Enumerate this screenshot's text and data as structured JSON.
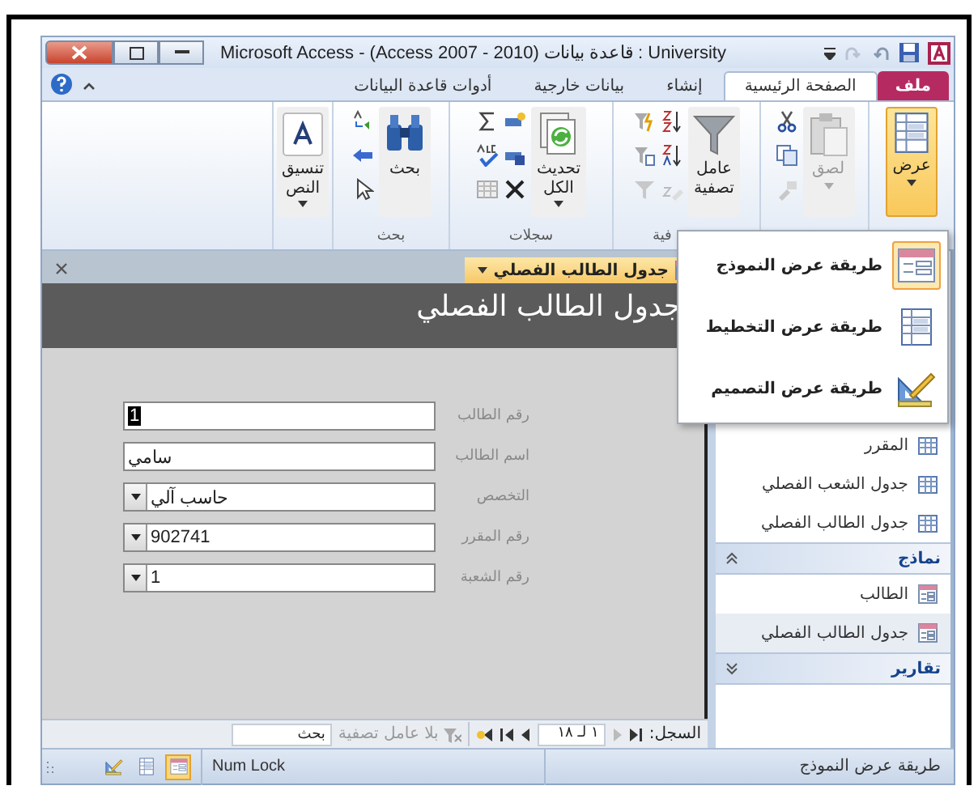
{
  "window": {
    "title": "Microsoft Access  -  (Access 2007 - 2010) قاعدة بيانات : University"
  },
  "tabs": [
    {
      "label": "ملف",
      "kind": "file",
      "selected": false
    },
    {
      "label": "الصفحة الرئيسية",
      "kind": "normal",
      "selected": true
    },
    {
      "label": "إنشاء",
      "kind": "normal",
      "selected": false
    },
    {
      "label": "بيانات خارجية",
      "kind": "normal",
      "selected": false
    },
    {
      "label": "أدوات قاعدة البيانات",
      "kind": "normal",
      "selected": false
    }
  ],
  "ribbon": {
    "groups": [
      {
        "kind": "view",
        "button": {
          "label": "عرض",
          "selected": true,
          "disabled": false
        }
      },
      {
        "kind": "clipboard",
        "button": {
          "label": "لصق",
          "selected": false,
          "disabled": true
        }
      },
      {
        "kind": "sort_filter",
        "label": "فية",
        "button": {
          "label": "عامل\nتصفية",
          "selected": false,
          "disabled": false
        }
      },
      {
        "kind": "records",
        "label": "سجلات",
        "button": {
          "label": "تحديث\nالكل",
          "selected": false,
          "disabled": false
        }
      },
      {
        "kind": "find",
        "label": "بحث",
        "button": {
          "label": "بحث",
          "selected": false,
          "disabled": false
        }
      },
      {
        "kind": "text_format",
        "button": {
          "label": "تنسيق\nالنص",
          "selected": false,
          "disabled": false
        }
      }
    ]
  },
  "view_menu": {
    "items": [
      {
        "label": "طريقة عرض النموذج",
        "kind": "form",
        "selected": true
      },
      {
        "label": "طريقة عرض التخطيط",
        "kind": "layout",
        "selected": false
      },
      {
        "label": "طريقة عرض التصميم",
        "kind": "design",
        "selected": false
      }
    ]
  },
  "document": {
    "tabs": [
      {
        "label": "جدول الطالب الفصلي",
        "selected": true
      }
    ],
    "form": {
      "title": "جدول الطالب الفصلي",
      "fields": [
        {
          "label": "رقم الطالب",
          "value": "1",
          "kind": "text",
          "focused": true
        },
        {
          "label": "اسم الطالب",
          "value": "سامي",
          "kind": "text",
          "focused": false
        },
        {
          "label": "التخصص",
          "value": "حاسب آلي",
          "kind": "combo",
          "focused": false
        },
        {
          "label": "رقم المقرر",
          "value": "902741",
          "kind": "combo",
          "focused": false
        },
        {
          "label": "رقم الشعبة",
          "value": "1",
          "kind": "combo",
          "focused": false
        }
      ]
    },
    "record_nav": {
      "label": "السجل:",
      "position": "١ لـ ١٨",
      "filter": "بلا عامل تصفية",
      "search": {
        "placeholder": "بحث"
      }
    }
  },
  "nav_pane": {
    "groups": [
      {
        "kind": "table",
        "items": [
          {
            "label": "المقرر",
            "selected": false
          },
          {
            "label": "جدول الشعب الفصلي",
            "selected": false
          },
          {
            "label": "جدول الطالب الفصلي",
            "selected": false
          }
        ]
      },
      {
        "kind": "form",
        "label": "نماذج",
        "expanded": true,
        "items": [
          {
            "label": "الطالب",
            "selected": false
          },
          {
            "label": "جدول الطالب الفصلي",
            "selected": true
          }
        ]
      },
      {
        "label": "تقارير",
        "expanded": false
      }
    ]
  },
  "status_bar": {
    "text": "طريقة عرض النموذج",
    "num_lock": "Num Lock",
    "views": [
      {
        "kind": "design",
        "selected": false
      },
      {
        "kind": "layout",
        "selected": false
      },
      {
        "kind": "form",
        "selected": true
      }
    ]
  }
}
